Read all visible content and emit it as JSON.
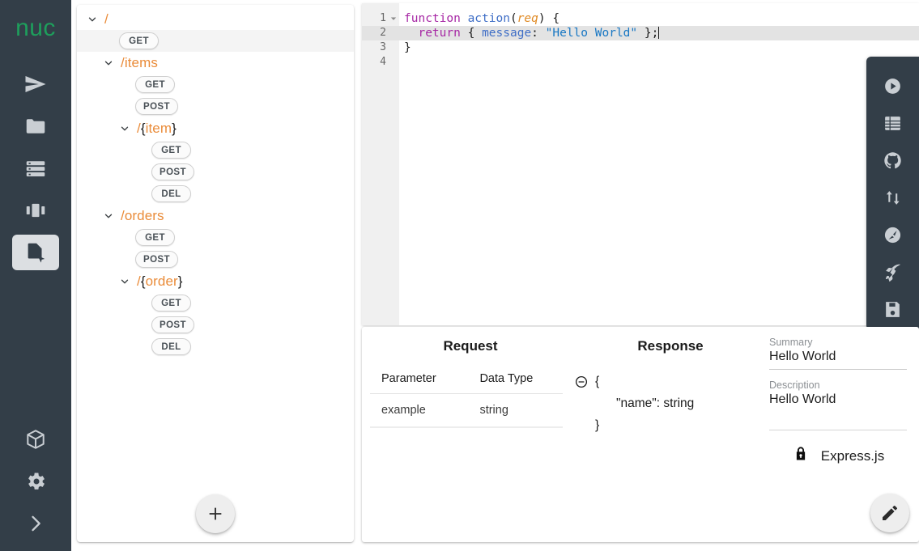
{
  "rail": {
    "logo": "nuc",
    "items": [
      {
        "label": "Deploy",
        "icon": "send-icon",
        "active": false
      },
      {
        "label": "Files",
        "icon": "folder-icon",
        "active": false
      },
      {
        "label": "Servers",
        "icon": "server-stack-icon",
        "active": false
      },
      {
        "label": "Columns",
        "icon": "columns-icon",
        "active": false
      },
      {
        "label": "API Designer",
        "icon": "file-cursor-icon",
        "active": true
      }
    ],
    "bottom_items": [
      {
        "label": "Packages",
        "icon": "cube-icon"
      },
      {
        "label": "Settings",
        "icon": "gear-icon"
      },
      {
        "label": "Expand",
        "icon": "chevron-right-icon"
      }
    ]
  },
  "tree": {
    "add_button_label": "+",
    "nodes": [
      {
        "kind": "path",
        "label": "/",
        "indent": 0,
        "expanded": true,
        "selected": false
      },
      {
        "kind": "verb",
        "label": "GET",
        "indent": 1,
        "selected": true
      },
      {
        "kind": "path",
        "label": "/items",
        "indent": 1,
        "expanded": true,
        "selected": false
      },
      {
        "kind": "verb",
        "label": "GET",
        "indent": 2,
        "selected": false
      },
      {
        "kind": "verb",
        "label": "POST",
        "indent": 2,
        "selected": false
      },
      {
        "kind": "path",
        "label": "/{item}",
        "indent": 2,
        "expanded": true,
        "selected": false
      },
      {
        "kind": "verb",
        "label": "GET",
        "indent": 3,
        "selected": false
      },
      {
        "kind": "verb",
        "label": "POST",
        "indent": 3,
        "selected": false
      },
      {
        "kind": "verb",
        "label": "DEL",
        "indent": 3,
        "selected": false
      },
      {
        "kind": "path",
        "label": "/orders",
        "indent": 1,
        "expanded": true,
        "selected": false
      },
      {
        "kind": "verb",
        "label": "GET",
        "indent": 2,
        "selected": false
      },
      {
        "kind": "verb",
        "label": "POST",
        "indent": 2,
        "selected": false
      },
      {
        "kind": "path",
        "label": "/{order}",
        "indent": 2,
        "expanded": true,
        "selected": false
      },
      {
        "kind": "verb",
        "label": "GET",
        "indent": 3,
        "selected": false
      },
      {
        "kind": "verb",
        "label": "POST",
        "indent": 3,
        "selected": false
      },
      {
        "kind": "verb",
        "label": "DEL",
        "indent": 3,
        "selected": false
      }
    ]
  },
  "editor": {
    "lines": [
      {
        "number": "1",
        "foldable": true,
        "current": false,
        "tokens": [
          {
            "t": "function",
            "c": "k-kw"
          },
          {
            "t": " ",
            "c": "k-plain"
          },
          {
            "t": "action",
            "c": "k-fn"
          },
          {
            "t": "(",
            "c": "k-plain"
          },
          {
            "t": "req",
            "c": "k-par"
          },
          {
            "t": ") {",
            "c": "k-plain"
          }
        ]
      },
      {
        "number": "2",
        "foldable": false,
        "current": true,
        "tokens": [
          {
            "t": "  ",
            "c": "k-plain"
          },
          {
            "t": "return",
            "c": "k-kw"
          },
          {
            "t": " { ",
            "c": "k-plain"
          },
          {
            "t": "message",
            "c": "k-prop"
          },
          {
            "t": ": ",
            "c": "k-plain"
          },
          {
            "t": "\"Hello World\"",
            "c": "k-str"
          },
          {
            "t": " };",
            "c": "k-plain"
          }
        ]
      },
      {
        "number": "3",
        "foldable": false,
        "current": false,
        "tokens": [
          {
            "t": "}",
            "c": "k-plain"
          }
        ]
      },
      {
        "number": "4",
        "foldable": false,
        "current": false,
        "tokens": [
          {
            "t": "",
            "c": "k-plain"
          }
        ]
      }
    ]
  },
  "tools": {
    "items": [
      {
        "label": "Run",
        "icon": "play-circle-icon"
      },
      {
        "label": "Logs",
        "icon": "list-table-icon"
      },
      {
        "label": "GitHub",
        "icon": "github-icon"
      },
      {
        "label": "Sync",
        "icon": "sync-arrows-icon"
      },
      {
        "label": "Inspect",
        "icon": "compass-icon"
      },
      {
        "label": "Deploy",
        "icon": "rocket-icon"
      },
      {
        "label": "Save",
        "icon": "floppy-save-icon"
      }
    ]
  },
  "details": {
    "request": {
      "title": "Request",
      "columns": [
        "Parameter",
        "Data Type"
      ],
      "rows": [
        {
          "parameter": "example",
          "data_type": "string"
        }
      ]
    },
    "response": {
      "title": "Response",
      "open_brace": "{",
      "field": "\"name\": string",
      "close_brace": "}"
    },
    "meta": {
      "summary_label": "Summary",
      "summary_value": "Hello World",
      "description_label": "Description",
      "description_value": "Hello World",
      "framework_name": "Express.js",
      "framework_icon": "lock-icon"
    },
    "edit_button_label": "Edit"
  },
  "colors": {
    "rail_bg": "#333e48",
    "logo_green": "#1e9e5c",
    "path_orange": "#ea8c3a",
    "icon_gray": "#c9ced3",
    "editor_gutter": "#f0f0f0"
  }
}
